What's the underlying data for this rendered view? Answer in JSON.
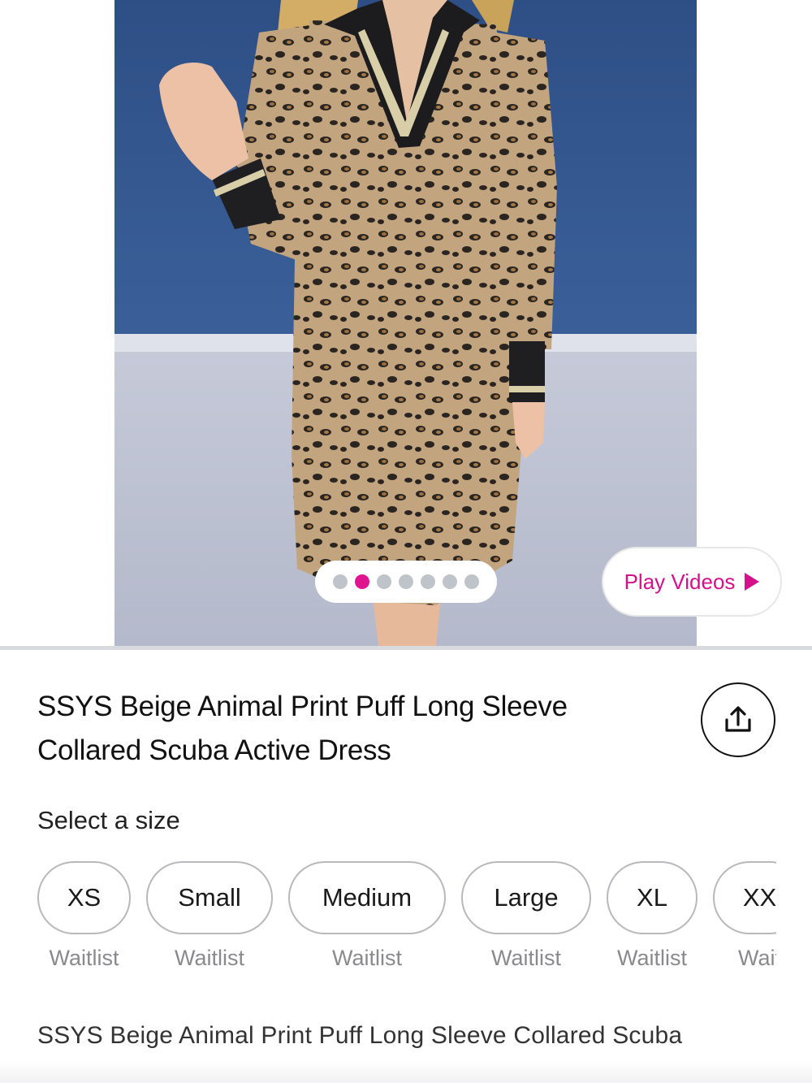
{
  "gallery": {
    "image_alt": "",
    "dot_count": 7,
    "active_dot_index": 1,
    "play_videos_label": "Play Videos",
    "play_icon": "play-triangle-icon"
  },
  "product": {
    "title_line1": "SSYS Beige Animal Print Puff Long Sleeve",
    "title_line2": "Collared Scuba Active Dress",
    "share_icon": "share-icon",
    "size_section_label": "Select a size",
    "sizes": [
      {
        "label": "XS",
        "status": "Waitlist"
      },
      {
        "label": "Small",
        "status": "Waitlist"
      },
      {
        "label": "Medium",
        "status": "Waitlist"
      },
      {
        "label": "Large",
        "status": "Waitlist"
      },
      {
        "label": "XL",
        "status": "Waitlist"
      },
      {
        "label": "XX",
        "status": "Wait"
      }
    ],
    "description_preview": "SSYS Beige Animal Print Puff Long Sleeve Collared Scuba"
  },
  "colors": {
    "accent": "#e0148f",
    "wall": "#33568f",
    "floor": "#b9bdd0"
  }
}
